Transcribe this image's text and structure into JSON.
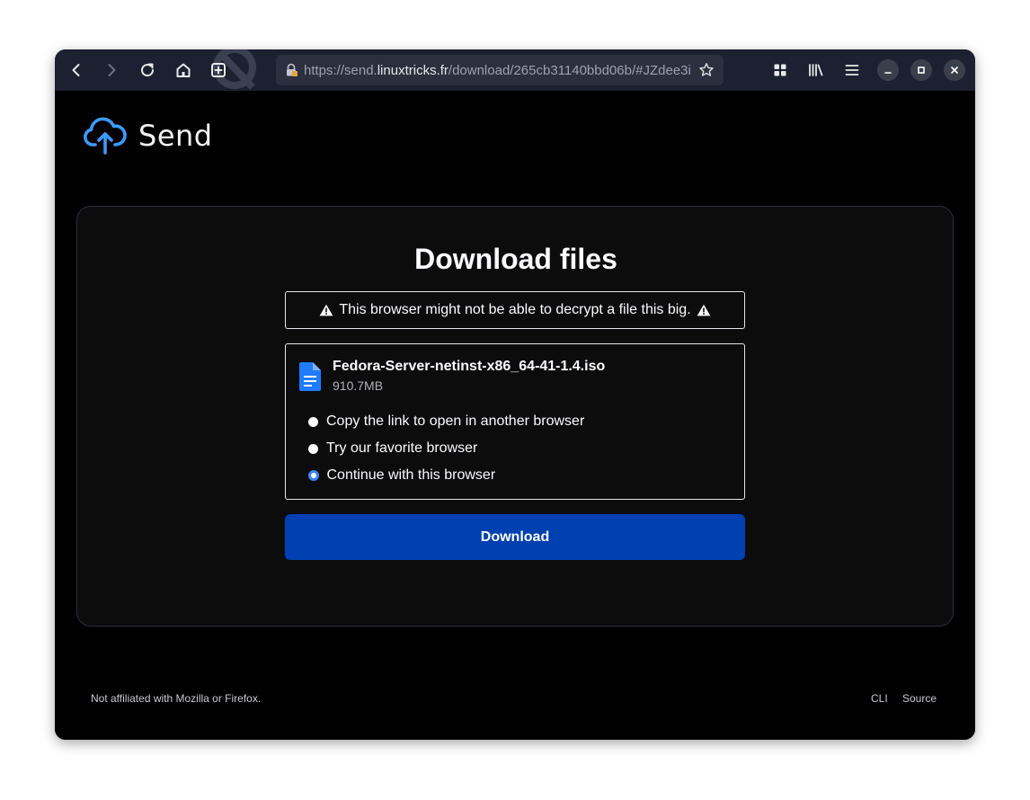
{
  "browser": {
    "url": {
      "prefix": "https://send.",
      "host": "linuxtricks.fr",
      "path": "/download/265cb31140bbd06b/#JZdee3i"
    }
  },
  "brand": {
    "name": "Send"
  },
  "main": {
    "title": "Download files",
    "warning": "This browser might not be able to decrypt a file this big.",
    "file": {
      "name": "Fedora-Server-netinst-x86_64-41-1.4.iso",
      "size": "910.7MB"
    },
    "options": [
      {
        "label": "Copy the link to open in another browser",
        "selected": false
      },
      {
        "label": "Try our favorite browser",
        "selected": false
      },
      {
        "label": "Continue with this browser",
        "selected": true
      }
    ],
    "download_label": "Download"
  },
  "footer": {
    "disclaimer": "Not affiliated with Mozilla or Firefox.",
    "links": {
      "cli": "CLI",
      "source": "Source"
    }
  },
  "colors": {
    "toolbar": "#1c2030",
    "accent": "#3b83f7",
    "button": "#0040b0",
    "page_bg": "#000000"
  },
  "icons": [
    "back-icon",
    "forward-icon",
    "reload-icon",
    "home-icon",
    "new-tab-icon",
    "lock-icon",
    "star-icon",
    "extensions-icon",
    "library-icon",
    "menu-icon",
    "minimize-icon",
    "maximize-icon",
    "close-icon",
    "warning-icon",
    "file-icon",
    "cloud-upload-icon"
  ]
}
